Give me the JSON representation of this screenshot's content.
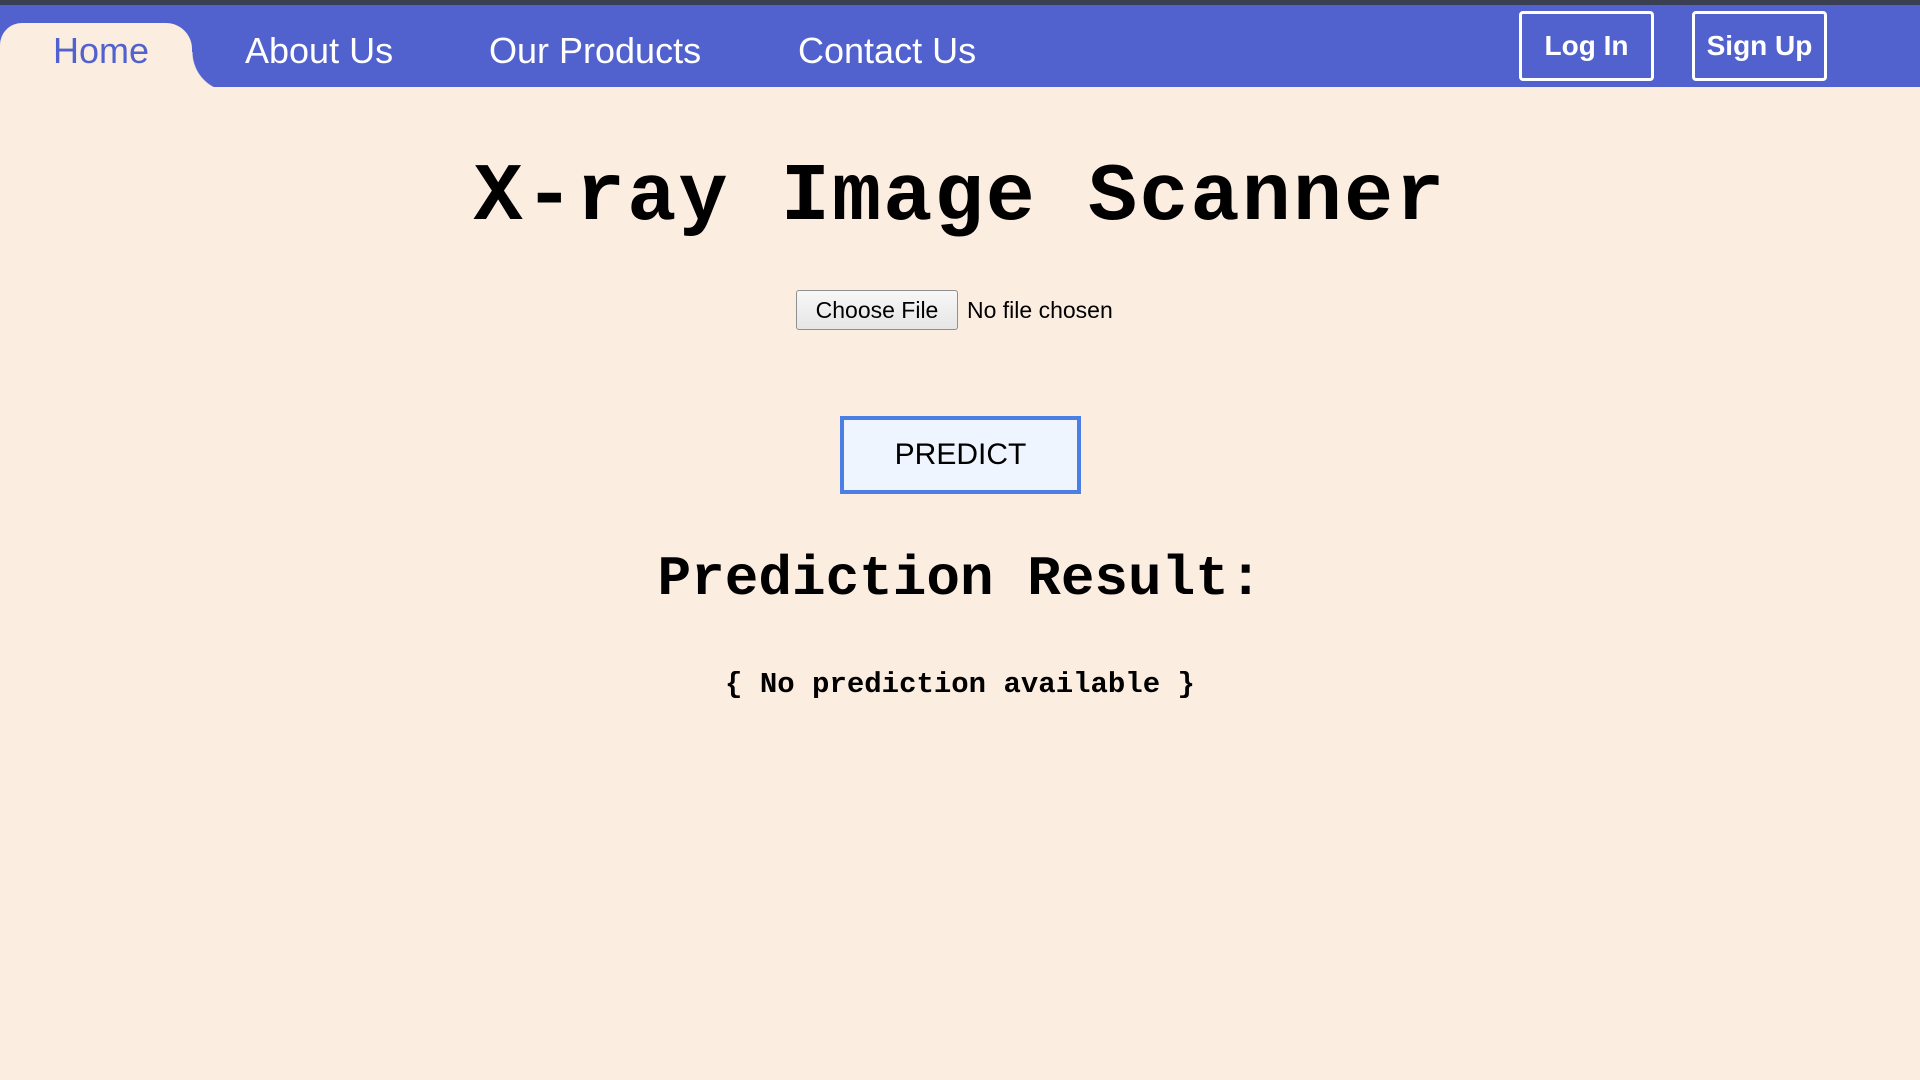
{
  "nav": {
    "home": "Home",
    "about": "About Us",
    "products": "Our Products",
    "contact": "Contact Us",
    "login": "Log In",
    "signup": "Sign Up"
  },
  "main": {
    "title": "X-ray Image Scanner",
    "file_button": "Choose File",
    "file_status": "No file chosen",
    "predict_button": "PREDICT",
    "result_heading": "Prediction Result:",
    "result_text": "{ No prediction available }"
  },
  "colors": {
    "nav_background": "#5162cf",
    "page_background": "#fcede1",
    "predict_border": "#4b7fe3"
  }
}
